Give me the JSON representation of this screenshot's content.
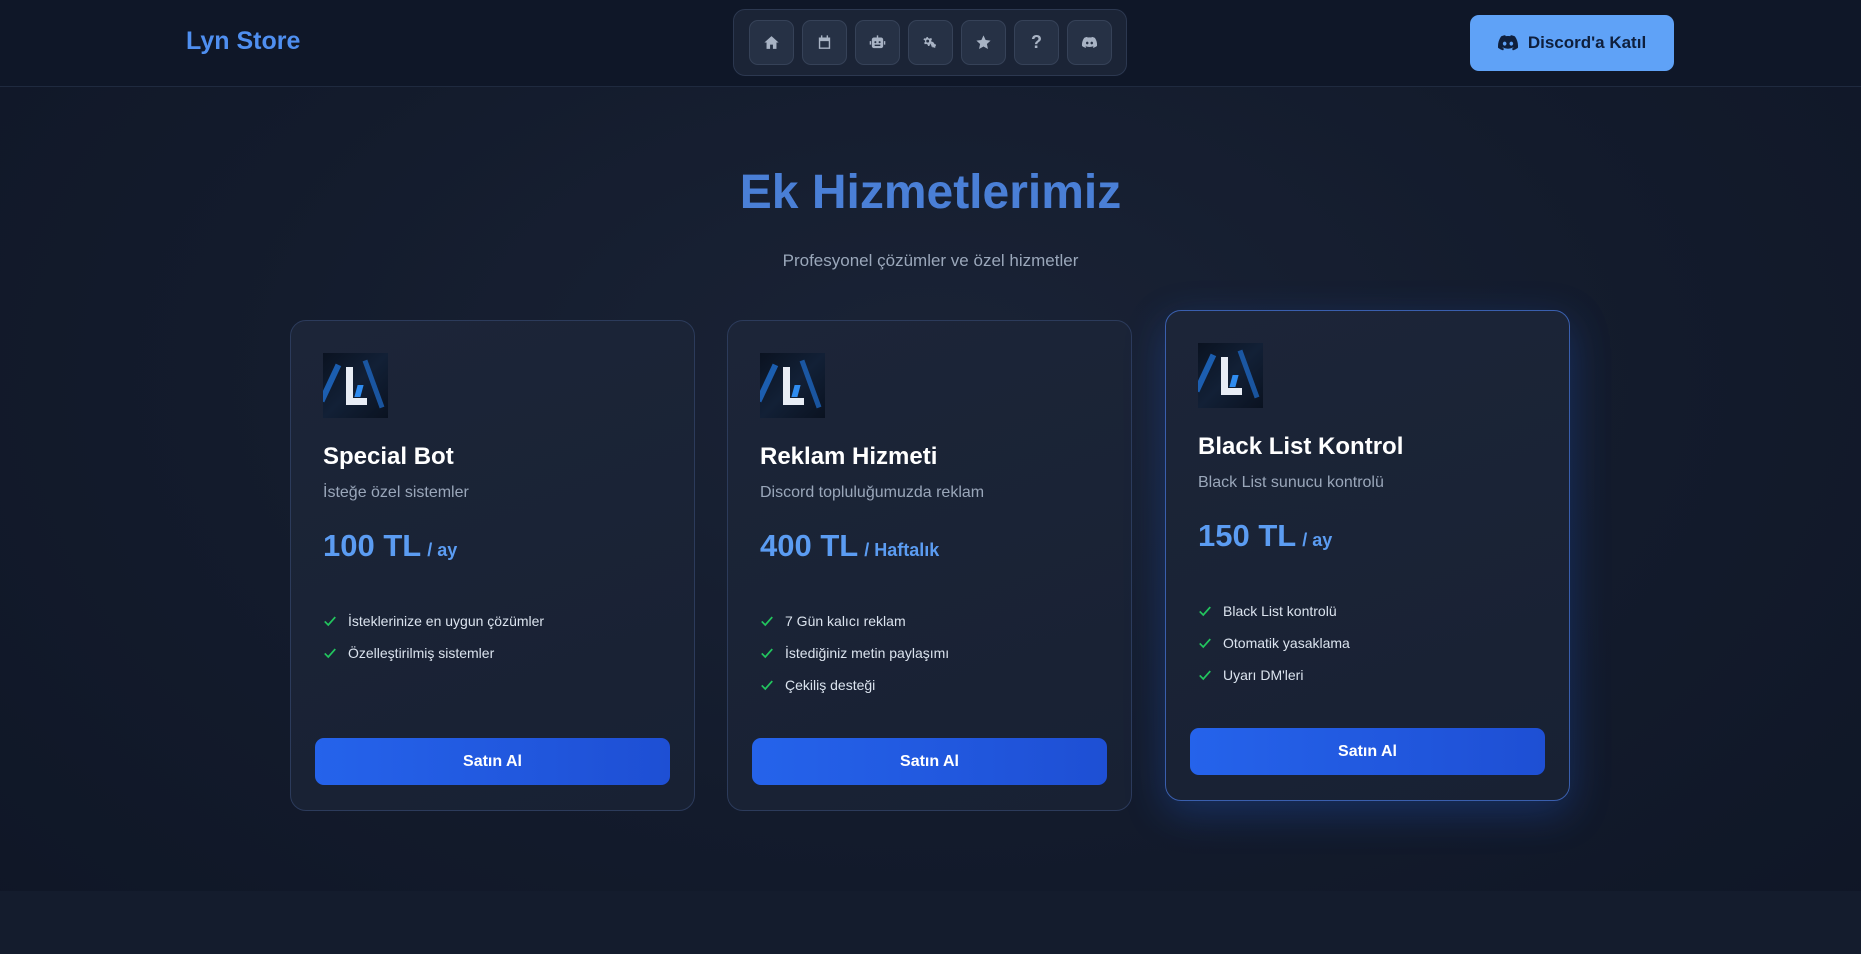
{
  "header": {
    "brand": "Lyn Store",
    "nav_icons": [
      "home-icon",
      "calendar-icon",
      "robot-icon",
      "gears-icon",
      "star-icon",
      "question-icon",
      "discord-icon"
    ],
    "nav_question_glyph": "?",
    "discord_button_label": "Discord'a Katıl"
  },
  "section": {
    "title": "Ek Hizmetlerimiz",
    "subtitle": "Profesyonel çözümler ve özel hizmetler"
  },
  "cards": [
    {
      "title": "Special Bot",
      "description": "İsteğe özel sistemler",
      "price": "100 TL",
      "period": "/ ay",
      "features": [
        "İsteklerinize en uygun çözümler",
        "Özelleştirilmiş sistemler"
      ],
      "button_label": "Satın Al"
    },
    {
      "title": "Reklam Hizmeti",
      "description": "Discord topluluğumuzda reklam",
      "price": "400 TL",
      "period": "/ Haftalık",
      "features": [
        "7 Gün kalıcı reklam",
        "İstediğiniz metin paylaşımı",
        "Çekiliş desteği"
      ],
      "button_label": "Satın Al"
    },
    {
      "title": "Black List Kontrol",
      "description": "Black List sunucu kontrolü",
      "price": "150 TL",
      "period": "/ ay",
      "features": [
        "Black List kontrolü",
        "Otomatik yasaklama",
        "Uyarı DM'leri"
      ],
      "button_label": "Satın Al"
    }
  ],
  "colors": {
    "brand": "#4f8ff0",
    "accent_button": "#2563eb",
    "discord_button": "#5fa2f7",
    "price": "#5b9cf2",
    "check": "#22c55e",
    "title": "#4a7fd6"
  }
}
